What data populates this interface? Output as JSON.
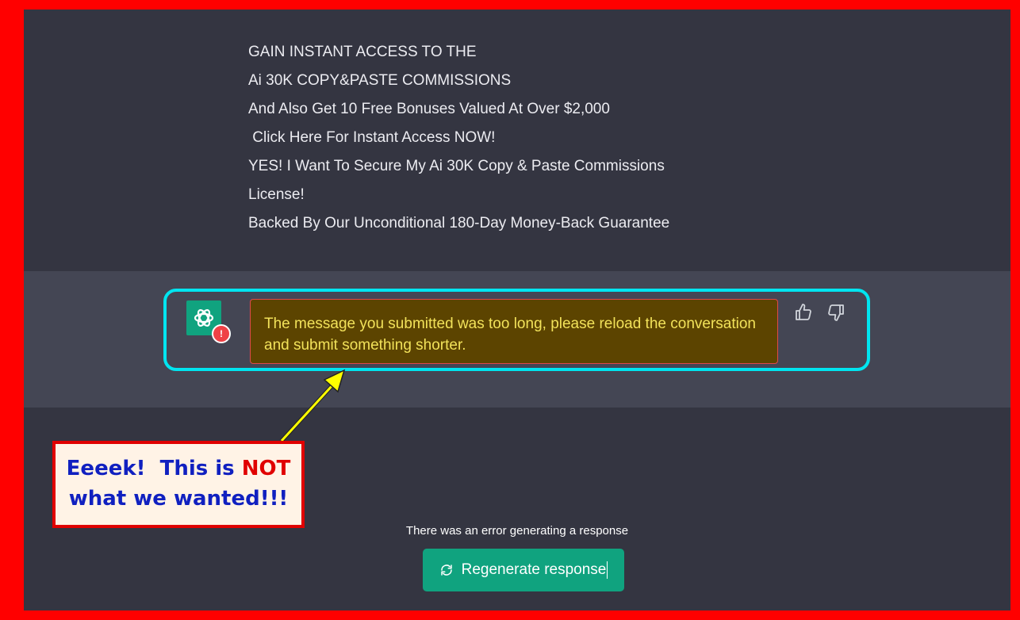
{
  "user_message": {
    "lines": [
      "GAIN INSTANT ACCESS TO THE",
      "Ai 30K COPY&PASTE COMMISSIONS",
      "And Also Get 10 Free Bonuses Valued At Over $2,000",
      " Click Here For Instant Access NOW!",
      "YES! I Want To Secure My Ai 30K Copy & Paste Commissions",
      "License!",
      "Backed By Our Unconditional 180-Day Money-Back Guarantee"
    ]
  },
  "assistant_message": {
    "avatar_icon": "openai-logo-icon",
    "error_badge": "!",
    "error_text": "The message you submitted was too long, please reload the conversation and submit something shorter.",
    "feedback": {
      "thumbs_up_icon": "thumbs-up-icon",
      "thumbs_down_icon": "thumbs-down-icon"
    }
  },
  "footer": {
    "error_notice": "There was an error generating a response",
    "regenerate_label": "Regenerate response"
  },
  "annotation": {
    "callout_line1_prefix": "Eeeek!  This is ",
    "callout_line1_emph": "NOT",
    "callout_line2": "what we wanted!!!"
  },
  "colors": {
    "border": "#ff0000",
    "background": "#343541",
    "assistant_bg": "#444654",
    "accent": "#10a37f",
    "highlight": "#00e5f0",
    "error_box": "#5c4400"
  }
}
